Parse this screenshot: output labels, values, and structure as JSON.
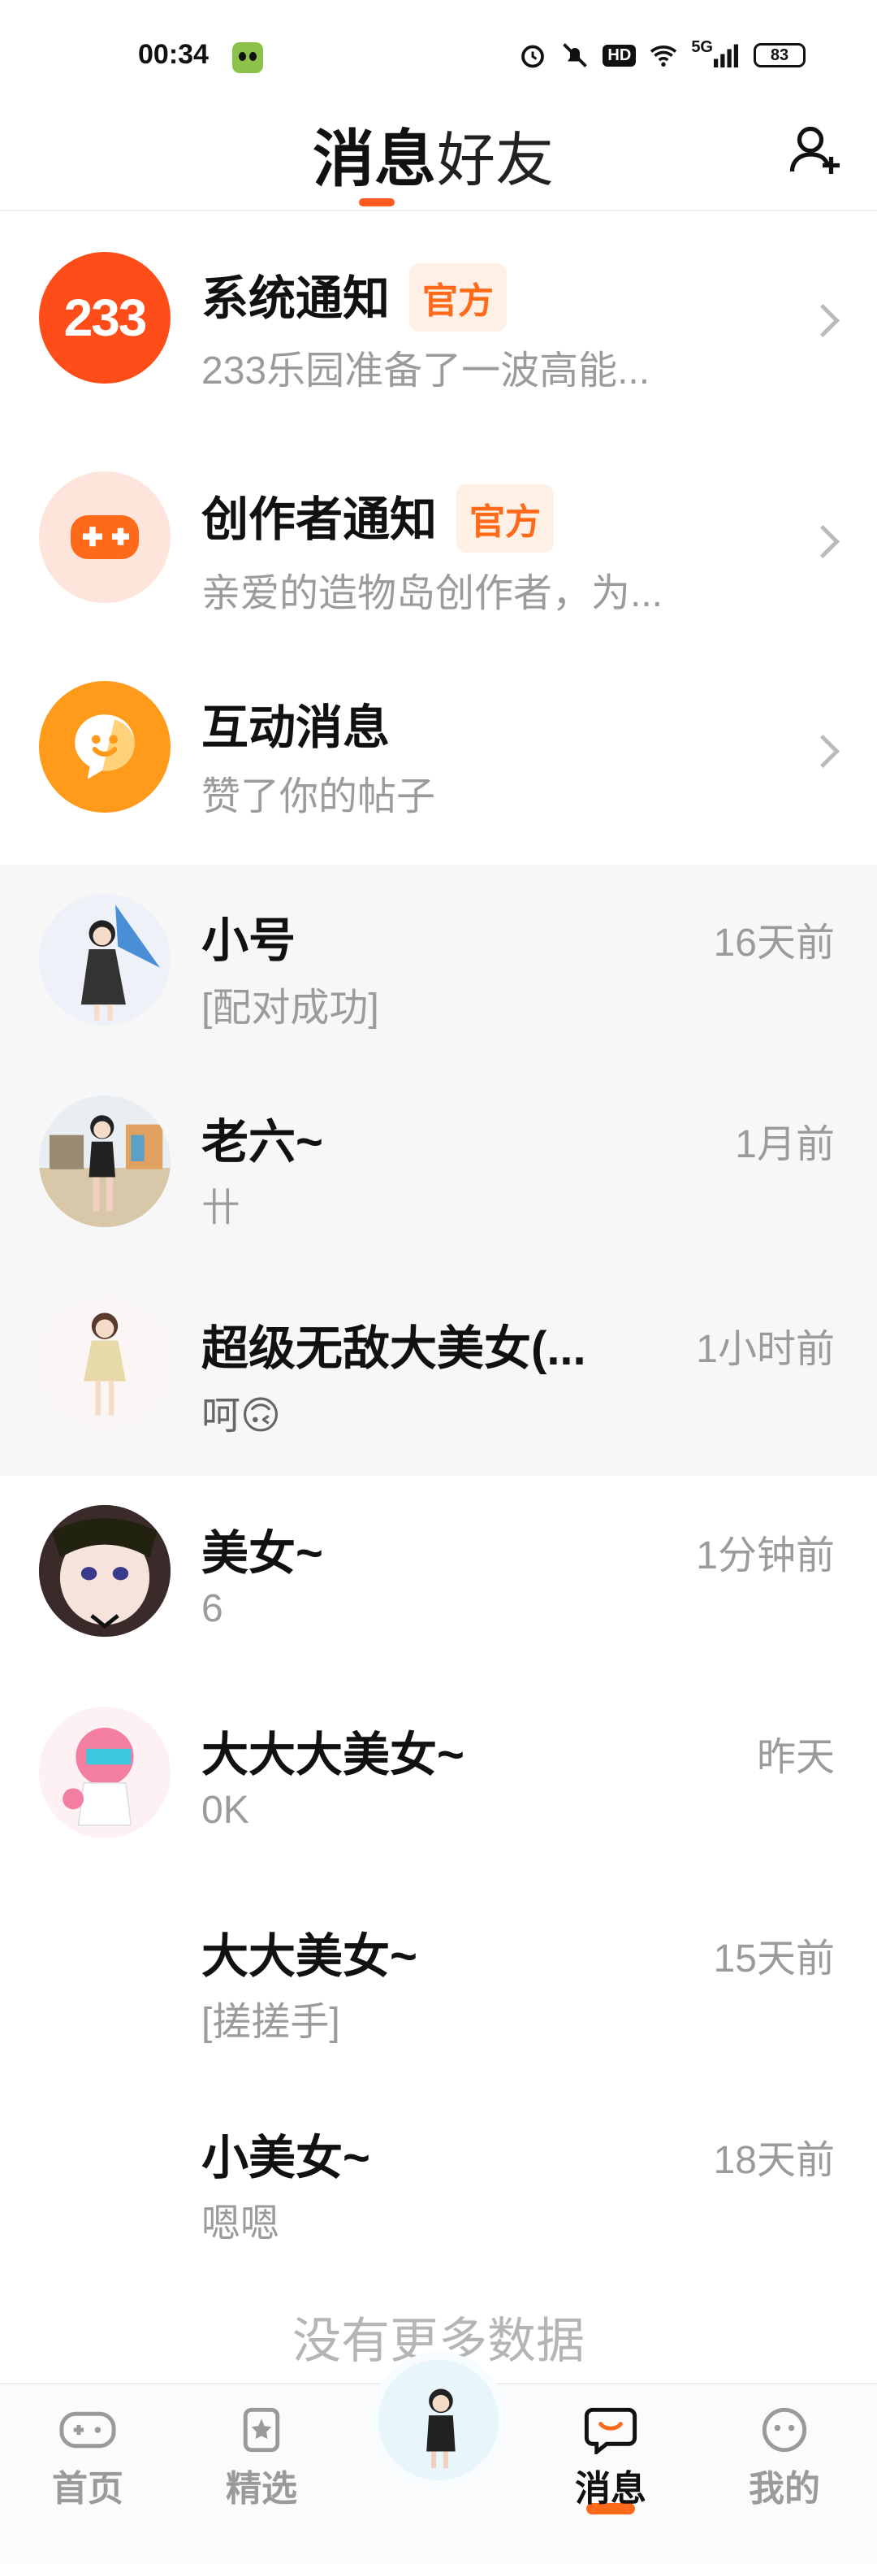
{
  "status_bar": {
    "time": "00:34",
    "network": "5G",
    "hd": "HD",
    "battery": "83"
  },
  "header": {
    "tab_messages": "消息",
    "tab_friends": "好友"
  },
  "system_items": [
    {
      "avatar_text": "233",
      "name": "系统通知",
      "badge": "官方",
      "preview": "233乐园准备了一波高能..."
    },
    {
      "name": "创作者通知",
      "badge": "官方",
      "preview": "亲爱的造物岛创作者，为..."
    },
    {
      "name": "互动消息",
      "preview": "赞了你的帖子"
    }
  ],
  "pinned_chats": [
    {
      "name": "小号",
      "preview": "[配对成功]",
      "time": "16天前"
    },
    {
      "name": "老六~",
      "preview": "卄",
      "time": "1月前"
    },
    {
      "name": "超级无敌大美女(...",
      "preview": "呵🙃",
      "time": "1小时前"
    }
  ],
  "chats": [
    {
      "name": "美女~",
      "preview": "6",
      "time": "1分钟前"
    },
    {
      "name": "大大大美女~",
      "preview": "0K",
      "time": "昨天"
    },
    {
      "name": "大大美女~",
      "preview": "[搓搓手]",
      "time": "15天前"
    },
    {
      "name": "小美女~",
      "preview": "嗯嗯",
      "time": "18天前"
    }
  ],
  "no_more": "没有更多数据",
  "bottom_nav": {
    "home": "首页",
    "featured": "精选",
    "messages": "消息",
    "mine": "我的"
  },
  "colors": {
    "accent": "#ff5a1f",
    "muted_text": "#9b9b9b",
    "pinned_bg": "#f7f7f7"
  }
}
